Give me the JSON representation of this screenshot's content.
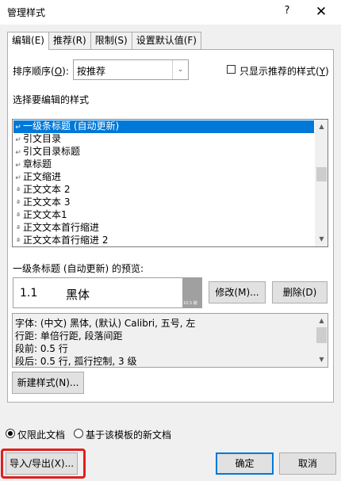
{
  "window": {
    "title": "管理样式",
    "help": "?",
    "close": "✕"
  },
  "tabs": [
    {
      "label": "编辑",
      "accel": "(E)"
    },
    {
      "label": "推荐",
      "accel": "(R)"
    },
    {
      "label": "限制",
      "accel": "(S)"
    },
    {
      "label": "设置默认值",
      "accel": "(F)"
    }
  ],
  "sort": {
    "label": "排序顺序(",
    "accel": "O",
    "label_end": "):",
    "value": "按推荐",
    "arrow": "⌄"
  },
  "recommended_only": {
    "label": "只显示推荐的样式(",
    "accel": "Y",
    "label_end": ")",
    "checked": false
  },
  "edit_label": "选择要编辑的样式",
  "style_list": {
    "items": [
      {
        "icon": "↵",
        "label": "一级条标题  (自动更新)",
        "selected": true
      },
      {
        "icon": "↵",
        "label": "引文目录",
        "selected": false
      },
      {
        "icon": "↵",
        "label": "引文目录标题",
        "selected": false
      },
      {
        "icon": "↵",
        "label": "章标题",
        "selected": false
      },
      {
        "icon": "↵",
        "label": "正文缩进",
        "selected": false
      },
      {
        "icon": "ª",
        "label": "正文文本 2",
        "selected": false
      },
      {
        "icon": "ª",
        "label": "正文文本 3",
        "selected": false
      },
      {
        "icon": "ª",
        "label": "正文文本1",
        "selected": false
      },
      {
        "icon": "ª",
        "label": "正文文本首行缩进",
        "selected": false
      },
      {
        "icon": "ª",
        "label": "正文文本首行缩进 2",
        "selected": false
      }
    ],
    "scroll_up": "▲",
    "scroll_down": "▼"
  },
  "preview": {
    "label": "一级条标题  (自动更新) 的预览:",
    "number": "1.1",
    "font": "黑体",
    "size": "10.5 磅"
  },
  "buttons": {
    "modify": "修改(M)...",
    "delete": "删除(D)",
    "new_style": "新建样式(N)...",
    "import_export": "导入/导出(X)...",
    "ok": "确定",
    "cancel": "取消"
  },
  "description": [
    "字体: (中文) 黑体, (默认) Calibri, 五号, 左",
    "  行距: 单倍行距, 段落间距",
    "  段前: 0.5 行",
    "  段后: 0.5 行, 孤行控制, 3 级"
  ],
  "scope": {
    "this_document": "仅限此文档",
    "new_documents": "基于该模板的新文档",
    "selected": "this_document"
  },
  "colors": {
    "selection": "#0078d7",
    "highlight_box": "#e02020"
  }
}
